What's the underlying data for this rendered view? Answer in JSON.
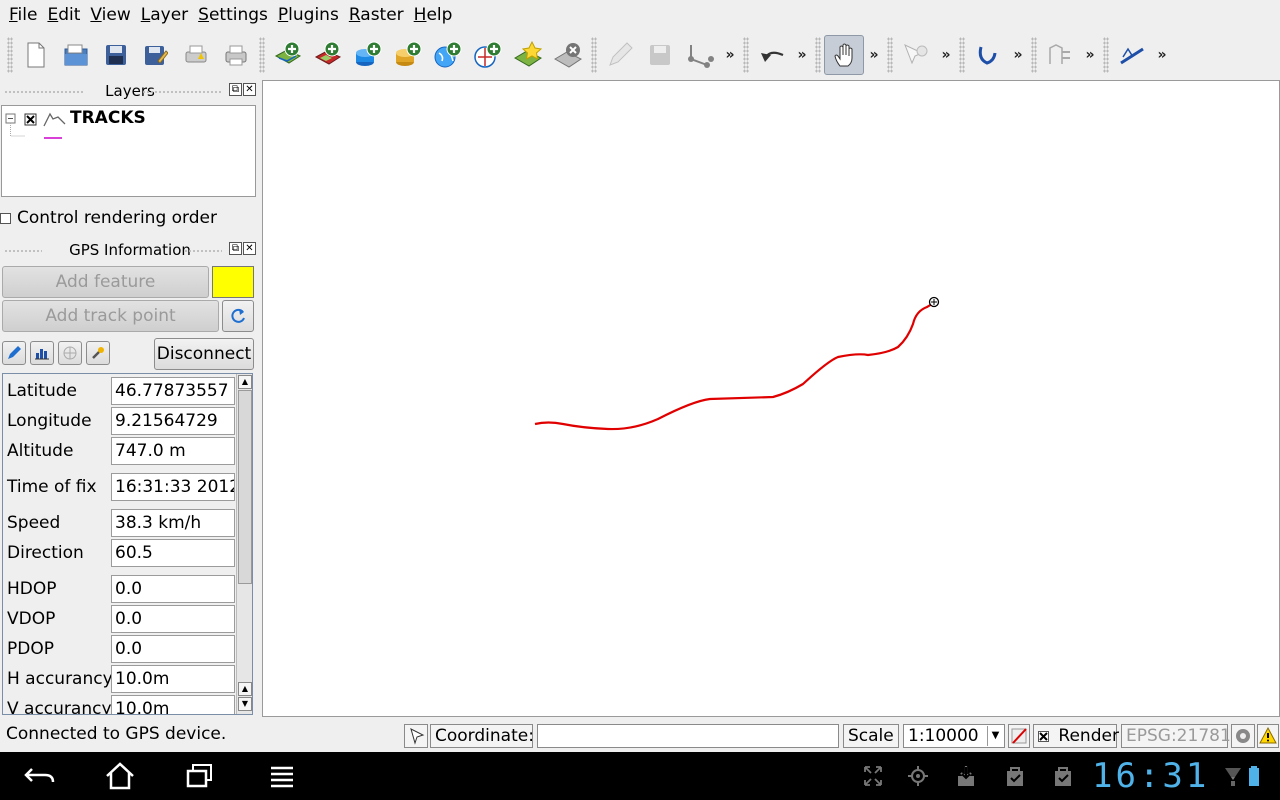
{
  "menubar": {
    "items": [
      "File",
      "Edit",
      "View",
      "Layer",
      "Settings",
      "Plugins",
      "Raster",
      "Help"
    ]
  },
  "toolbar": {
    "overflow_glyph": "»",
    "buttons": [
      "new-project",
      "open-project",
      "save-project",
      "save-as",
      "print-composer",
      "print",
      "add-vector-layer",
      "add-raster-layer",
      "add-postgis-layer",
      "add-spatialite-layer",
      "add-wms-layer",
      "add-wfs-layer",
      "new-shapefile",
      "remove-layer",
      "toggle-editing",
      "save-edits",
      "add-feature",
      "undo",
      "pan",
      "identify",
      "select",
      "field-calculator",
      "spell-check"
    ]
  },
  "layers_panel": {
    "title": "Layers",
    "layer_name": "TRACKS",
    "layer_checked": true,
    "control_rendering_order": "Control rendering order"
  },
  "gps_panel": {
    "title": "GPS Information",
    "add_feature": "Add feature",
    "add_track_point": "Add track point",
    "disconnect": "Disconnect",
    "track_color": "#ffff00",
    "fields": [
      {
        "label": "Latitude",
        "value": "46.77873557"
      },
      {
        "label": "Longitude",
        "value": "9.21564729"
      },
      {
        "label": "Altitude",
        "value": "747.0 m"
      },
      {
        "label": "Time of fix",
        "value": "16:31:33 2012"
      },
      {
        "label": "Speed",
        "value": "38.3 km/h"
      },
      {
        "label": "Direction",
        "value": "60.5"
      },
      {
        "label": "HDOP",
        "value": "0.0"
      },
      {
        "label": "VDOP",
        "value": "0.0"
      },
      {
        "label": "PDOP",
        "value": "0.0"
      },
      {
        "label": "H accurancy",
        "value": "10.0m"
      },
      {
        "label": "V accurancy",
        "value": "10.0m"
      }
    ]
  },
  "map": {
    "track_color": "#e00000"
  },
  "statusbar": {
    "message": "Connected to GPS device.",
    "coordinate_label": "Coordinate:",
    "coordinate_value": "",
    "scale_label": "Scale",
    "scale_value": "1:10000",
    "render_label": "Render",
    "render_checked": true,
    "crs": "EPSG:21781"
  },
  "system": {
    "clock": "16:31",
    "accent": "#4fb2e8"
  }
}
